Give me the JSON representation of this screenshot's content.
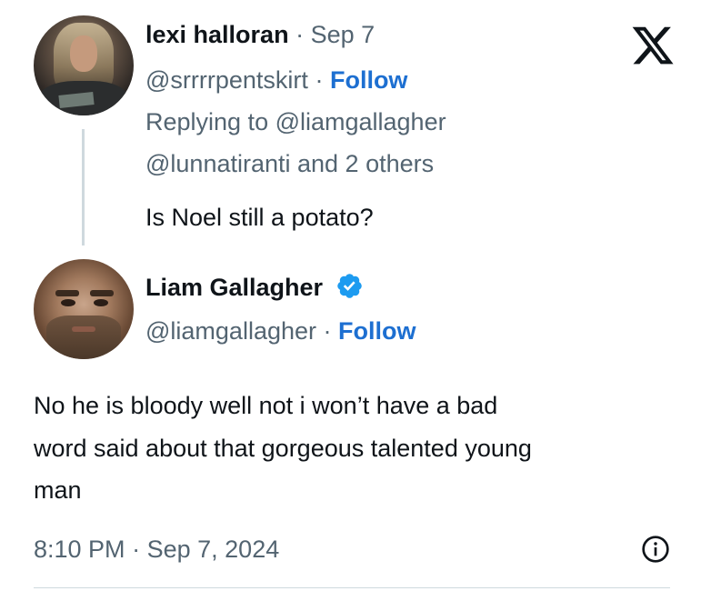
{
  "reply_to_tweet": {
    "author_name": "lexi halloran",
    "separator": "·",
    "date": "Sep 7",
    "handle": "@srrrrpentskirt",
    "follow_label": "Follow",
    "replying_line_1": "Replying to @liamgallagher",
    "replying_line_2": "@lunnatiranti and 2 others",
    "text": "Is Noel still a potato?"
  },
  "main_tweet": {
    "author_name": "Liam Gallagher",
    "verified": true,
    "handle": "@liamgallagher",
    "separator": "·",
    "follow_label": "Follow",
    "text_line_1": "No he is bloody well not i won’t have a bad",
    "text_line_2": "word said about that gorgeous talented young",
    "text_line_3": "man",
    "time": "8:10 PM",
    "separator_2": "·",
    "date": "Sep 7, 2024"
  },
  "icons": {
    "brand": "x-logo-icon",
    "verified": "verified-badge-icon",
    "info": "info-icon"
  },
  "colors": {
    "link": "#1d6fd1",
    "verified": "#1d9bf0",
    "muted": "#536471",
    "text": "#0f1419"
  }
}
